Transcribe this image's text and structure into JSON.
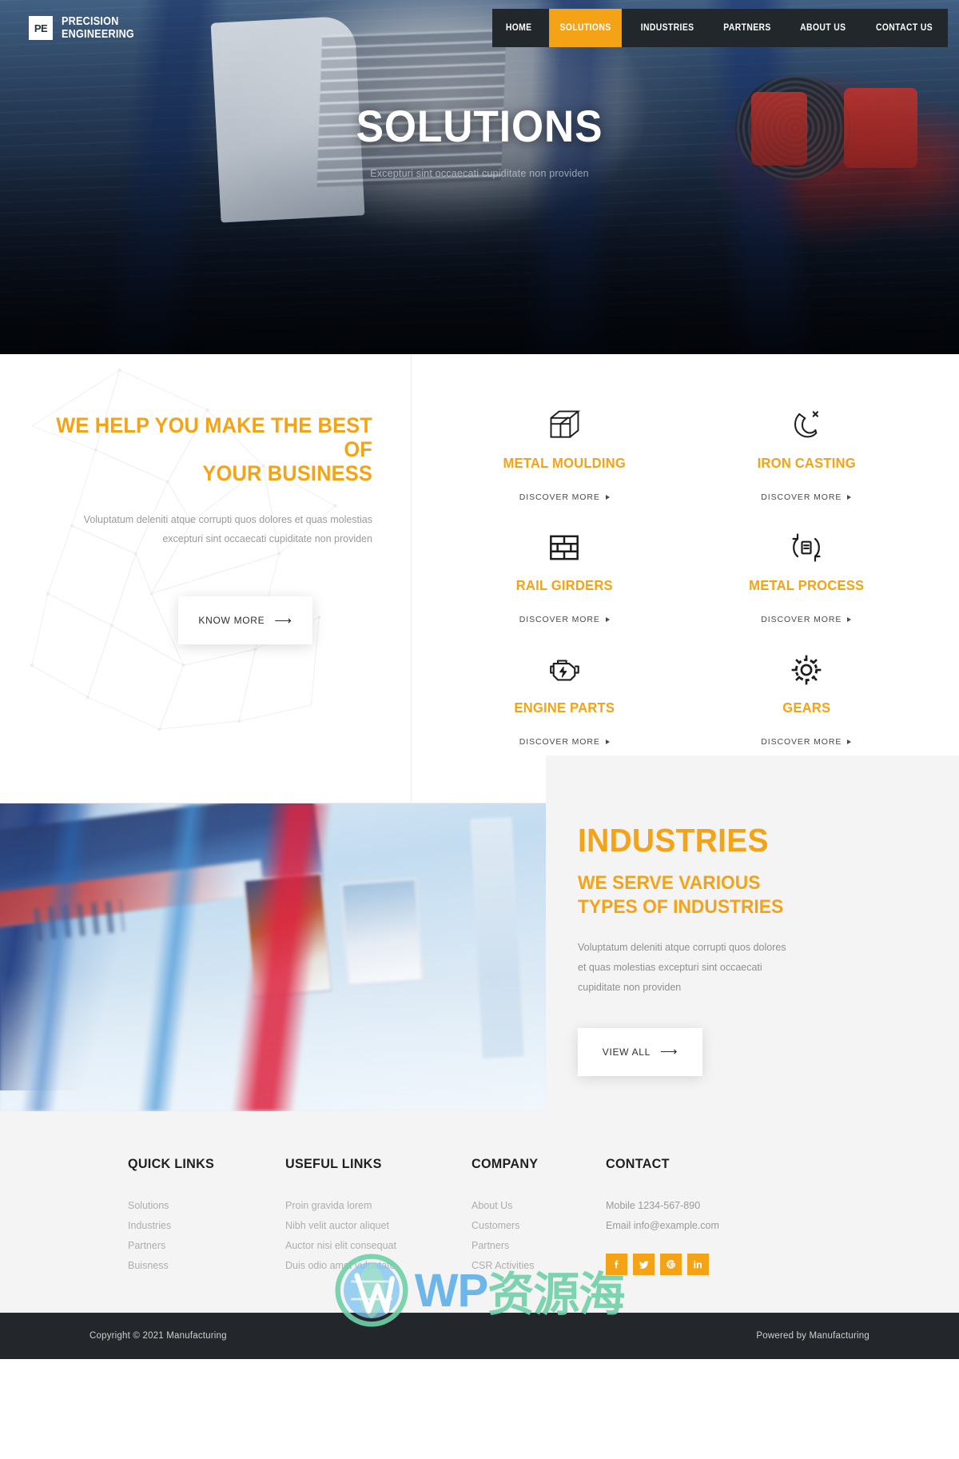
{
  "brand": {
    "mark": "PE",
    "line1": "PRECISION",
    "line2": "ENGINEERING"
  },
  "nav": {
    "items": [
      {
        "label": "HOME",
        "active": false
      },
      {
        "label": "SOLUTIONS",
        "active": true
      },
      {
        "label": "INDUSTRIES",
        "active": false
      },
      {
        "label": "PARTNERS",
        "active": false
      },
      {
        "label": "ABOUT US",
        "active": false
      },
      {
        "label": "CONTACT US",
        "active": false
      }
    ]
  },
  "hero": {
    "title": "SOLUTIONS",
    "subtitle": "Excepturi sint occaecati cupiditate non providen"
  },
  "intro": {
    "title_line1": "WE HELP YOU MAKE THE BEST OF",
    "title_line2": "YOUR BUSINESS",
    "paragraph": "Voluptatum deleniti atque corrupti quos dolores et quas molestias excepturi sint occaecati cupiditate non providen",
    "button_label": "KNOW MORE"
  },
  "services": {
    "discover_label": "DISCOVER MORE",
    "items": [
      {
        "name": "METAL MOULDING",
        "icon": "cube-icon"
      },
      {
        "name": "IRON CASTING",
        "icon": "magnet-icon"
      },
      {
        "name": "RAIL GIRDERS",
        "icon": "brick-wall-icon"
      },
      {
        "name": "METAL PROCESS",
        "icon": "recycle-process-icon"
      },
      {
        "name": "ENGINE PARTS",
        "icon": "engine-icon"
      },
      {
        "name": "GEARS",
        "icon": "gear-icon"
      }
    ]
  },
  "industries": {
    "kicker": "INDUSTRIES",
    "heading_line1": "WE SERVE VARIOUS",
    "heading_line2": "TYPES OF INDUSTRIES",
    "paragraph": "Voluptatum deleniti atque corrupti quos dolores et quas molestias excepturi sint occaecati cupiditate non providen",
    "button_label": "VIEW ALL"
  },
  "footer": {
    "columns": [
      {
        "title": "QUICK LINKS",
        "links": [
          "Solutions",
          "Industries",
          "Partners",
          "Buisness"
        ]
      },
      {
        "title": "USEFUL LINKS",
        "links": [
          "Proin gravida lorem",
          "Nibh velit auctor aliquet",
          "Auctor nisi elit consequat",
          "Duis odio amet vulputate"
        ]
      },
      {
        "title": "COMPANY",
        "links": [
          "About Us",
          "Customers",
          "Partners",
          "CSR Activities"
        ]
      }
    ],
    "contact": {
      "title": "CONTACT",
      "mobile": "Mobile 1234-567-890",
      "email": "Email info@example.com",
      "socials": [
        {
          "name": "facebook-icon"
        },
        {
          "name": "twitter-icon"
        },
        {
          "name": "google-icon"
        },
        {
          "name": "linkedin-icon"
        }
      ]
    },
    "copyright": "Copyright © 2021 Manufacturing",
    "powered_by": "Powered by Manufacturing"
  },
  "watermark": {
    "text_left": "WP",
    "text_right": "资源海"
  },
  "colors": {
    "accent": "#f5a316",
    "dark": "#23272b",
    "muted": "#adadad",
    "panel": "#f4f4f4"
  }
}
